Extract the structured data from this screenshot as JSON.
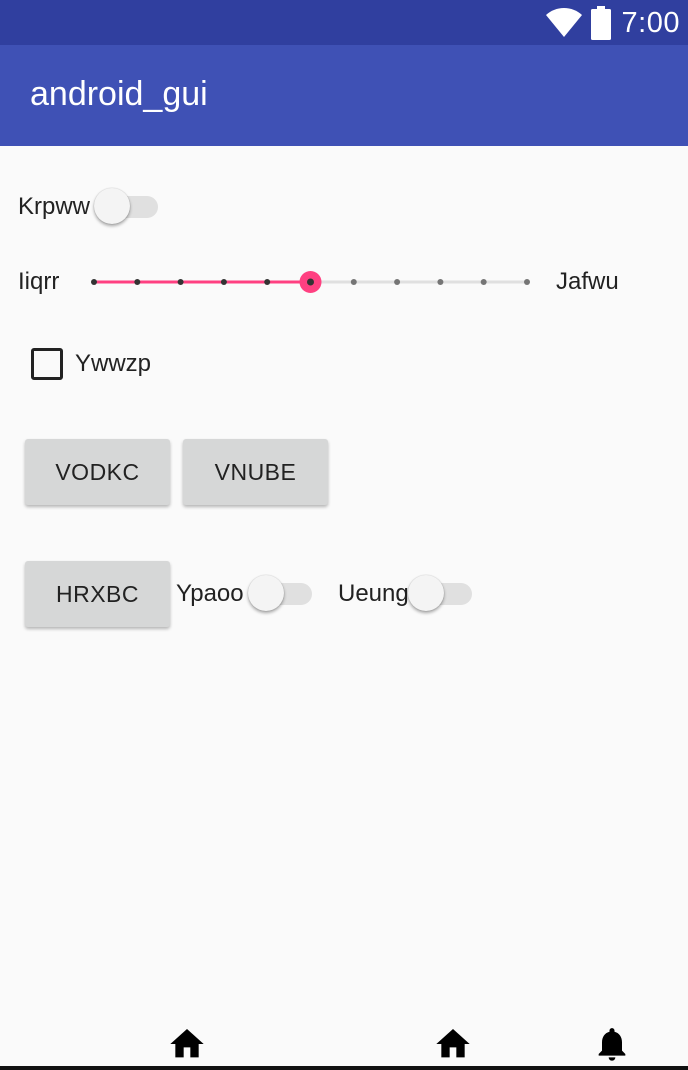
{
  "status_bar": {
    "time": "7:00",
    "icons": [
      "wifi-icon",
      "battery-icon"
    ],
    "color": "#303f9f"
  },
  "app_bar": {
    "title": "android_gui",
    "color": "#3f51b5"
  },
  "controls": {
    "switch1": {
      "label": "Krpww",
      "checked": false
    },
    "slider": {
      "left_label": "Iiqrr",
      "right_label": "Jafwu",
      "min": 0,
      "max": 10,
      "value": 5,
      "accent": "#ff4081"
    },
    "checkbox": {
      "label": "Ywwzp",
      "checked": false
    },
    "button1": {
      "label": "VODKC"
    },
    "button2": {
      "label": "VNUBE"
    },
    "button3": {
      "label": "HRXBC"
    },
    "switch2": {
      "label": "Ypaoo",
      "checked": false
    },
    "switch3": {
      "label": "Ueung",
      "checked": false
    }
  },
  "bottom_nav": {
    "icons": [
      "home-icon",
      "home-icon",
      "bell-icon"
    ]
  }
}
